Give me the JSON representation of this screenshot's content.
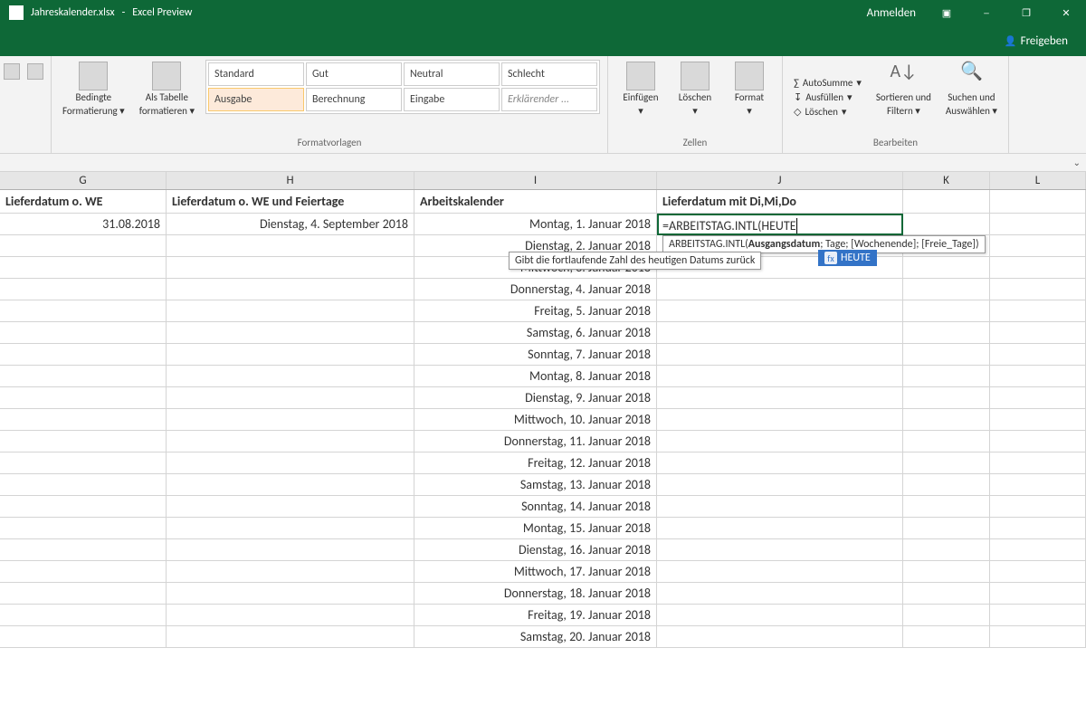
{
  "title": {
    "file": "Jahreskalender.xlsx",
    "app": "Excel Preview"
  },
  "titlebar": {
    "signin": "Anmelden"
  },
  "share": {
    "label": "Freigeben"
  },
  "ribbon": {
    "conditional": {
      "l1": "Bedingte",
      "l2": "Formatierung"
    },
    "astable": {
      "l1": "Als Tabelle",
      "l2": "formatieren"
    },
    "styles_label": "Formatvorlagen",
    "styles": [
      "Standard",
      "Gut",
      "Neutral",
      "Schlecht",
      "Ausgabe",
      "Berechnung",
      "Eingabe",
      "Erklärender ..."
    ],
    "insert": "Einfügen",
    "delete": "Löschen",
    "format": "Format",
    "cells_label": "Zellen",
    "autosum": "AutoSumme",
    "fill": "Ausfüllen",
    "clear": "Löschen",
    "sort": {
      "l1": "Sortieren und",
      "l2": "Filtern"
    },
    "find": {
      "l1": "Suchen und",
      "l2": "Auswählen"
    },
    "edit_label": "Bearbeiten"
  },
  "columns": {
    "g": "G",
    "h": "H",
    "i": "I",
    "j": "J",
    "k": "K",
    "l": "L"
  },
  "headers": {
    "g": "Lieferdatum o. WE",
    "h": "Lieferdatum o. WE und Feiertage",
    "i": "Arbeitskalender",
    "j": "Lieferdatum mit Di,Mi,Do"
  },
  "row2": {
    "g": "31.08.2018",
    "h": "Dienstag, 4. September 2018"
  },
  "formula": {
    "text": "=ARBEITSTAG.INTL(HEUTE",
    "tip_fn": "ARBEITSTAG.INTL(",
    "tip_args": "Ausgangsdatum; Tage; [Wochenende]; [Freie_Tage])",
    "tip_bold": "Ausgangsdatum",
    "date_desc_pre": "Gibt die fortlaufende Zahl des heutigen Datums zurück",
    "auto_item": "HEUTE"
  },
  "dates": [
    "Montag, 1. Januar 2018",
    "Dienstag, 2. Januar 2018",
    "Mittwoch, 3. Januar 2018",
    "Donnerstag, 4. Januar 2018",
    "Freitag, 5. Januar 2018",
    "Samstag, 6. Januar 2018",
    "Sonntag, 7. Januar 2018",
    "Montag, 8. Januar 2018",
    "Dienstag, 9. Januar 2018",
    "Mittwoch, 10. Januar 2018",
    "Donnerstag, 11. Januar 2018",
    "Freitag, 12. Januar 2018",
    "Samstag, 13. Januar 2018",
    "Sonntag, 14. Januar 2018",
    "Montag, 15. Januar 2018",
    "Dienstag, 16. Januar 2018",
    "Mittwoch, 17. Januar 2018",
    "Donnerstag, 18. Januar 2018",
    "Freitag, 19. Januar 2018",
    "Samstag, 20. Januar 2018"
  ]
}
